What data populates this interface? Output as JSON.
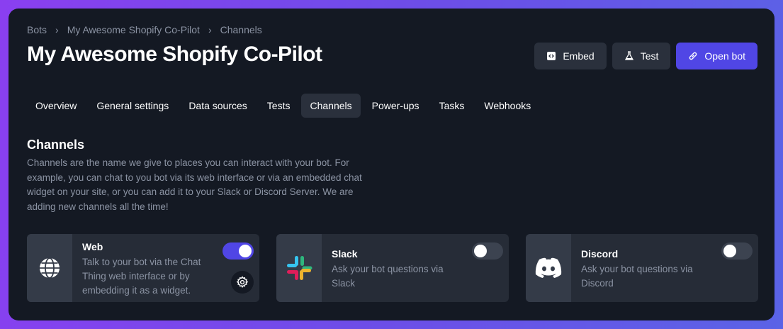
{
  "breadcrumb": {
    "items": [
      "Bots",
      "My Awesome Shopify Co-Pilot",
      "Channels"
    ]
  },
  "page": {
    "title": "My Awesome Shopify Co-Pilot"
  },
  "actions": {
    "embed_label": "Embed",
    "test_label": "Test",
    "open_label": "Open bot"
  },
  "tabs": [
    "Overview",
    "General settings",
    "Data sources",
    "Tests",
    "Channels",
    "Power-ups",
    "Tasks",
    "Webhooks"
  ],
  "active_tab": "Channels",
  "section": {
    "title": "Channels",
    "description": "Channels are the name we give to places you can interact with your bot. For example, you can chat to you bot via its web interface or via an embedded chat widget on your site, or you can add it to your Slack or Discord Server. We are adding new channels all the time!"
  },
  "channels": [
    {
      "name": "Web",
      "description": "Talk to your bot via the Chat Thing web interface or by embedding it as a widget.",
      "enabled": true,
      "icon": "globe-icon"
    },
    {
      "name": "Slack",
      "description": "Ask your bot questions via Slack",
      "enabled": false,
      "icon": "slack-icon"
    },
    {
      "name": "Discord",
      "description": "Ask your bot questions via Discord",
      "enabled": false,
      "icon": "discord-icon"
    }
  ],
  "colors": {
    "primary": "#5046e5",
    "panel": "#141923",
    "card": "#262c37"
  }
}
